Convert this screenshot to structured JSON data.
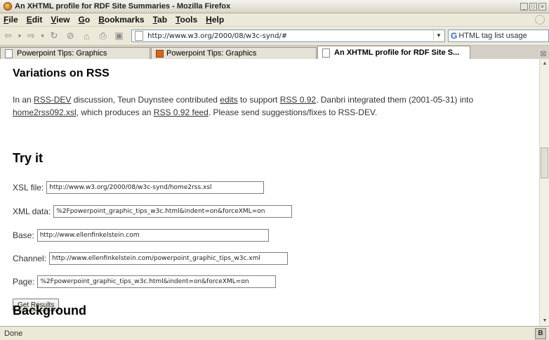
{
  "window": {
    "title": "An XHTML profile for RDF Site Summaries - Mozilla Firefox"
  },
  "menu": {
    "items": [
      {
        "u": "F",
        "rest": "ile"
      },
      {
        "u": "E",
        "rest": "dit"
      },
      {
        "u": "V",
        "rest": "iew"
      },
      {
        "u": "G",
        "rest": "o"
      },
      {
        "u": "B",
        "rest": "ookmarks"
      },
      {
        "u": "T",
        "rest": "ab"
      },
      {
        "u": "T",
        "rest": "ools"
      },
      {
        "u": "H",
        "rest": "elp"
      }
    ]
  },
  "navbar": {
    "url": "http://www.w3.org/2000/08/w3c-synd/#",
    "search_value": "HTML tag list usage"
  },
  "tabs": [
    {
      "label": "Powerpoint Tips: Graphics",
      "icon": "page-icon"
    },
    {
      "label": "Powerpoint Tips: Graphics",
      "icon": "powerpoint-icon"
    },
    {
      "label": "An XHTML profile for RDF Site S...",
      "icon": "page-icon",
      "active": true
    }
  ],
  "page": {
    "heading_variations": "Variations on RSS",
    "intro": {
      "t1": "In an ",
      "link1": "RSS-DEV",
      "t2": " discussion, Teun Duynstee contributed ",
      "link2": "edits",
      "t3": " to support ",
      "link3": "RSS 0.92",
      "t4": ". Danbri integrated them (2001-05-31) into ",
      "link4": "home2rss092.xsl",
      "t5": ", which produces an ",
      "link5": "RSS 0.92 feed",
      "t6": ". Please send suggestions/fixes to RSS-DEV."
    },
    "heading_try": "Try it",
    "form": {
      "xsl_label": "XSL file:",
      "xsl_value": "http://www.w3.org/2000/08/w3c-synd/home2rss.xsl",
      "xml_label": "XML data:",
      "xml_value": "%2Fpowerpoint_graphic_tips_w3c.html&indent=on&forceXML=on",
      "base_label": "Base:",
      "base_value": "http://www.ellenfinkelstein.com",
      "channel_label": "Channel:",
      "channel_value": "http://www.ellenfinkelstein.com/powerpoint_graphic_tips_w3c.xml",
      "page_label": "Page:",
      "page_value": "%2Fpowerpoint_graphic_tips_w3c.html&indent=on&forceXML=on",
      "submit_label": "Get Results"
    },
    "heading_background": "Background"
  },
  "status": {
    "text": "Done",
    "badge": "B"
  }
}
